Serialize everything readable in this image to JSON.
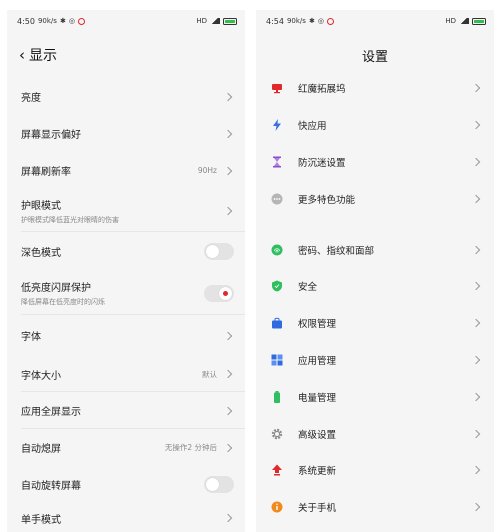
{
  "left": {
    "status": {
      "time": "4:50",
      "speed": "90k/s",
      "network": "HD"
    },
    "header": {
      "title": "显示"
    },
    "rows": [
      {
        "title": "亮度",
        "value": ""
      },
      {
        "title": "屏幕显示偏好",
        "value": ""
      },
      {
        "title": "屏幕刷新率",
        "value": "90Hz"
      },
      {
        "title": "护眼模式",
        "subtitle": "护眼模式降低蓝光对眼睛的伤害"
      },
      {
        "title": "深色模式"
      },
      {
        "title": "低亮度闪屏保护",
        "subtitle": "降低屏幕在低亮度时的闪烁"
      },
      {
        "title": "字体",
        "value": ""
      },
      {
        "title": "字体大小",
        "value": "默认"
      },
      {
        "title": "应用全屏显示",
        "value": ""
      },
      {
        "title": "自动熄屏",
        "value": "无操作2 分钟后"
      },
      {
        "title": "自动旋转屏幕"
      },
      {
        "title": "单手模式"
      }
    ],
    "toggles": {
      "dark_mode": false,
      "low_brightness_flicker": true,
      "auto_rotate": false
    }
  },
  "right": {
    "status": {
      "time": "4:54",
      "speed": "90k/s",
      "network": "HD"
    },
    "header": {
      "title": "设置"
    },
    "group1": [
      {
        "label": "红魔拓展坞",
        "icon": "monitor-icon",
        "color": "#e0282d"
      },
      {
        "label": "快应用",
        "icon": "lightning-icon",
        "color": "#3b6fe0"
      },
      {
        "label": "防沉迷设置",
        "icon": "hourglass-icon",
        "color": "#8a4fd0"
      },
      {
        "label": "更多特色功能",
        "icon": "more-icon",
        "color": "#9a9a9a"
      }
    ],
    "group2": [
      {
        "label": "密码、指纹和面部",
        "icon": "fingerprint-icon",
        "color": "#2fbf5f"
      },
      {
        "label": "安全",
        "icon": "shield-icon",
        "color": "#2fbf5f"
      },
      {
        "label": "权限管理",
        "icon": "bag-icon",
        "color": "#2f6be0"
      },
      {
        "label": "应用管理",
        "icon": "grid-icon",
        "color": "#2f6be0"
      },
      {
        "label": "电量管理",
        "icon": "battery-icon",
        "color": "#2fbf5f"
      },
      {
        "label": "高级设置",
        "icon": "gear-icon",
        "color": "#8a8a8a"
      },
      {
        "label": "系统更新",
        "icon": "update-icon",
        "color": "#e0282d"
      },
      {
        "label": "关于手机",
        "icon": "info-icon",
        "color": "#f08a1c"
      }
    ]
  }
}
